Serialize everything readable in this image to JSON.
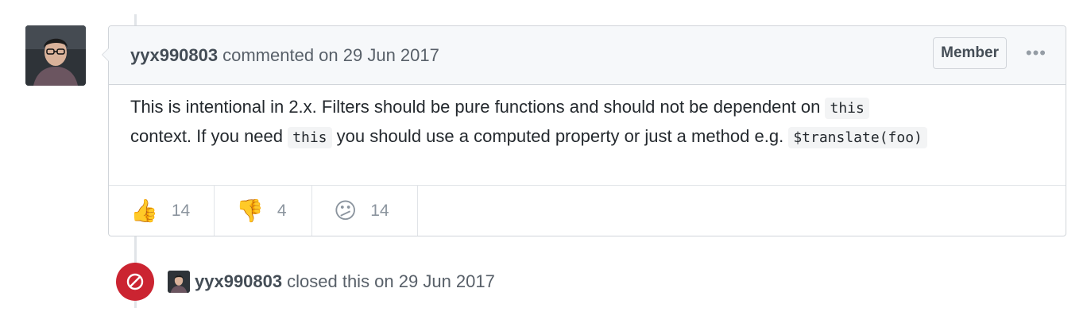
{
  "comment": {
    "author": "yyx990803",
    "header_text": "commented on 29 Jun 2017",
    "badge": "Member",
    "menu_icon": "kebab-horizontal-icon",
    "body": {
      "line1_text": "This is intentional in 2.x. Filters should be pure functions and should not be dependent on",
      "code1": "this",
      "line2_text_a": "context. If you need",
      "code2": "this",
      "line2_text_b": "you should use a computed property or just a method e.g.",
      "code3": "$translate(foo)"
    },
    "reactions": [
      {
        "icon": "thumbs-up-icon",
        "emoji": "👍",
        "count": "14"
      },
      {
        "icon": "thumbs-down-icon",
        "emoji": "👎",
        "count": "4"
      },
      {
        "icon": "confused-icon",
        "emoji": "😕",
        "count": "14"
      }
    ]
  },
  "closed_event": {
    "icon": "circle-slash-icon",
    "author": "yyx990803",
    "text": "closed this on 29 Jun 2017",
    "color": "#cb2431"
  }
}
